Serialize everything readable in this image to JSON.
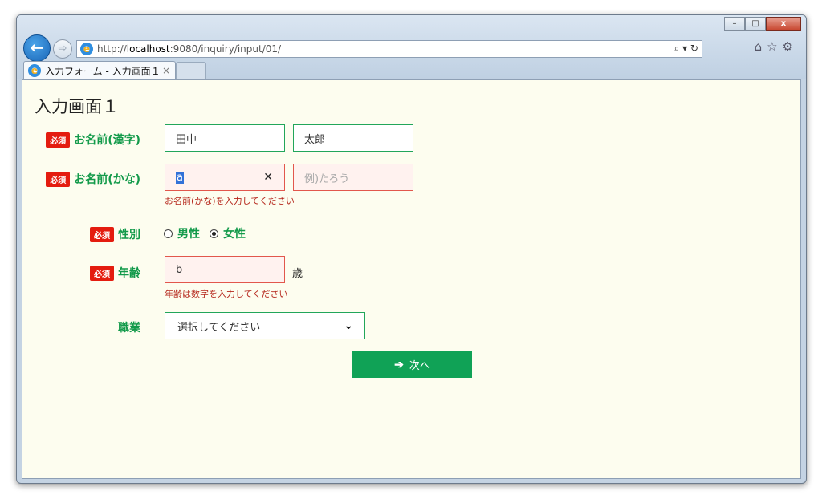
{
  "browser": {
    "url_prefix": "http://",
    "url_host": "localhost",
    "url_rest": ":9080/inquiry/input/01/",
    "address_tools": "⌕ ▾ ↻",
    "tab_title": "入力フォーム - 入力画面１",
    "tab_close": "×",
    "window_min": "–",
    "window_max": "□",
    "window_close": "x"
  },
  "form": {
    "title": "入力画面１",
    "required_badge": "必須",
    "name_kanji": {
      "label": "お名前(漢字)",
      "last": "田中",
      "first": "太郎"
    },
    "name_kana": {
      "label": "お名前(かな)",
      "last": "a",
      "first_placeholder": "例)たろう",
      "error": "お名前(かな)を入力してください"
    },
    "gender": {
      "label": "性別",
      "options": [
        "男性",
        "女性"
      ],
      "selected": "女性"
    },
    "age": {
      "label": "年齢",
      "value": "b",
      "unit": "歳",
      "error": "年齢は数字を入力してください"
    },
    "occupation": {
      "label": "職業",
      "selected": "選択してください"
    },
    "next_button": "次へ"
  },
  "colors": {
    "accent_green": "#10a256",
    "required_red": "#e41c0f",
    "error_red": "#b5261b",
    "page_bg": "#fdfdef"
  }
}
